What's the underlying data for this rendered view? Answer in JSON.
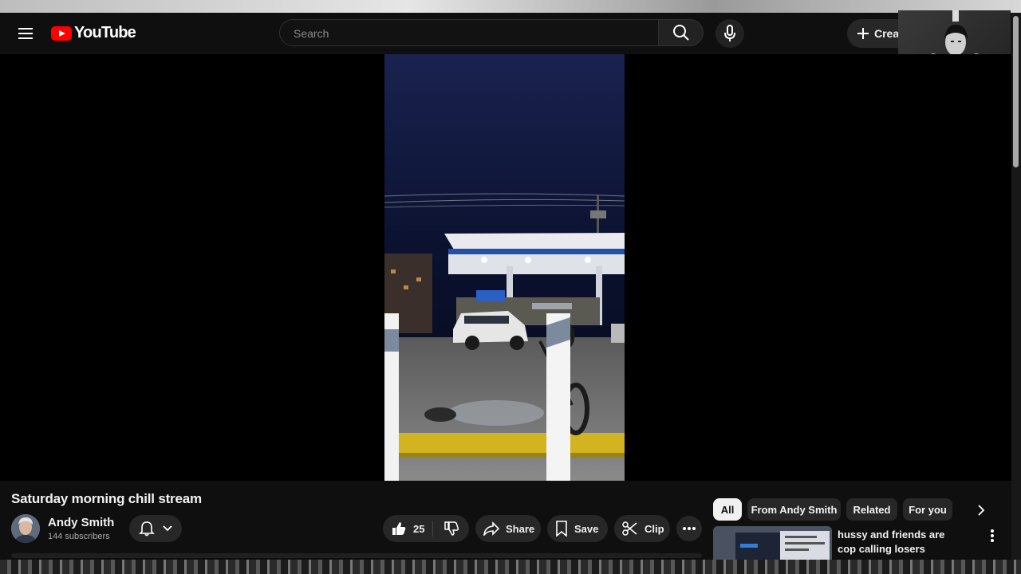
{
  "masthead": {
    "logo_text": "YouTube",
    "search_placeholder": "Search",
    "create_label": "Create"
  },
  "video": {
    "title": "Saturday morning chill stream"
  },
  "channel": {
    "name": "Andy Smith",
    "subscribers": "144 subscribers"
  },
  "actions": {
    "like_count": "25",
    "share_label": "Share",
    "save_label": "Save",
    "clip_label": "Clip"
  },
  "chips": [
    {
      "label": "All",
      "active": true
    },
    {
      "label": "From Andy Smith",
      "active": false
    },
    {
      "label": "Related",
      "active": false
    },
    {
      "label": "For you",
      "active": false
    }
  ],
  "recommendation": {
    "title": "hussy and friends are cop calling losers"
  },
  "colors": {
    "background": "#0f0f0f",
    "surface": "#272727",
    "brand_red": "#ff0000",
    "text": "#f1f1f1",
    "muted": "#aaaaaa"
  },
  "icons": [
    "menu-icon",
    "search-icon",
    "mic-icon",
    "plus-icon",
    "bell-icon",
    "chevron-down-icon",
    "thumbs-up-icon",
    "thumbs-down-icon",
    "share-icon",
    "bookmark-icon",
    "scissors-icon",
    "more-horizontal-icon",
    "chevron-right-icon",
    "more-vertical-icon"
  ]
}
